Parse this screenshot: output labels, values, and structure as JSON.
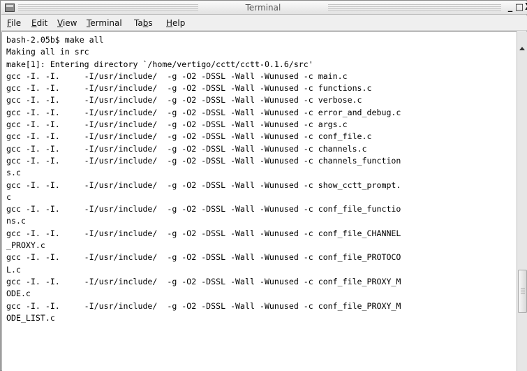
{
  "window": {
    "title": "Terminal",
    "controls": {
      "minimize": "_",
      "maximize": "□",
      "close": "X"
    }
  },
  "menu": [
    {
      "mnemonic": "F",
      "rest": "ile"
    },
    {
      "mnemonic": "E",
      "rest": "dit"
    },
    {
      "mnemonic": "V",
      "rest": "iew"
    },
    {
      "mnemonic": "T",
      "rest": "erminal"
    },
    {
      "pre": "Ta",
      "mnemonic": "b",
      "rest": "s"
    },
    {
      "mnemonic": "H",
      "rest": "elp"
    }
  ],
  "terminal": {
    "lines": [
      "bash-2.05b$ make all",
      "Making all in src",
      "make[1]: Entering directory `/home/vertigo/cctt/cctt-0.1.6/src'",
      "gcc -I. -I.     -I/usr/include/  -g -O2 -DSSL -Wall -Wunused -c main.c",
      "gcc -I. -I.     -I/usr/include/  -g -O2 -DSSL -Wall -Wunused -c functions.c",
      "gcc -I. -I.     -I/usr/include/  -g -O2 -DSSL -Wall -Wunused -c verbose.c",
      "gcc -I. -I.     -I/usr/include/  -g -O2 -DSSL -Wall -Wunused -c error_and_debug.c",
      "gcc -I. -I.     -I/usr/include/  -g -O2 -DSSL -Wall -Wunused -c args.c",
      "gcc -I. -I.     -I/usr/include/  -g -O2 -DSSL -Wall -Wunused -c conf_file.c",
      "gcc -I. -I.     -I/usr/include/  -g -O2 -DSSL -Wall -Wunused -c channels.c",
      "gcc -I. -I.     -I/usr/include/  -g -O2 -DSSL -Wall -Wunused -c channels_function",
      "s.c",
      "gcc -I. -I.     -I/usr/include/  -g -O2 -DSSL -Wall -Wunused -c show_cctt_prompt.",
      "c",
      "gcc -I. -I.     -I/usr/include/  -g -O2 -DSSL -Wall -Wunused -c conf_file_functio",
      "ns.c",
      "gcc -I. -I.     -I/usr/include/  -g -O2 -DSSL -Wall -Wunused -c conf_file_CHANNEL",
      "_PROXY.c",
      "gcc -I. -I.     -I/usr/include/  -g -O2 -DSSL -Wall -Wunused -c conf_file_PROTOCO",
      "L.c",
      "gcc -I. -I.     -I/usr/include/  -g -O2 -DSSL -Wall -Wunused -c conf_file_PROXY_M",
      "ODE.c",
      "gcc -I. -I.     -I/usr/include/  -g -O2 -DSSL -Wall -Wunused -c conf_file_PROXY_M",
      "ODE_LIST.c"
    ]
  }
}
